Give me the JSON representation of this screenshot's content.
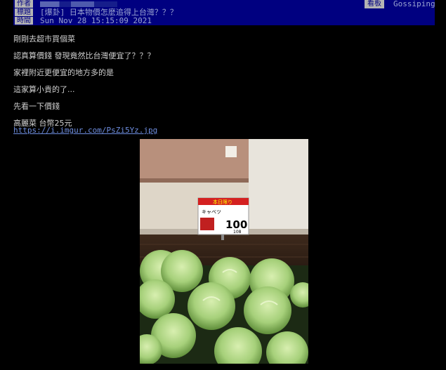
{
  "header": {
    "author_label": "作者",
    "title_label": "標題",
    "time_label": "時間",
    "title": "[爆卦] 日本物價怎麼追得上台灣？？？",
    "time": "Sun Nov 28 15:15:09 2021",
    "board_label": "看板",
    "board": "Gossiping"
  },
  "body": {
    "lines": [
      "剛剛去超市買個菜",
      "認真算價錢 發現竟然比台灣便宜了？？？",
      "家裡附近更便宜的地方多的是",
      "這家算小貴的了...",
      "先看一下價錢",
      "高麗菜 台幣25元"
    ],
    "link": "https://i.imgur.com/PsZi5Yz.jpg"
  },
  "image": {
    "price_tag_top": "本日限り",
    "price_tag_name": "キャベツ",
    "price_value": "100",
    "price_tax": "108"
  }
}
